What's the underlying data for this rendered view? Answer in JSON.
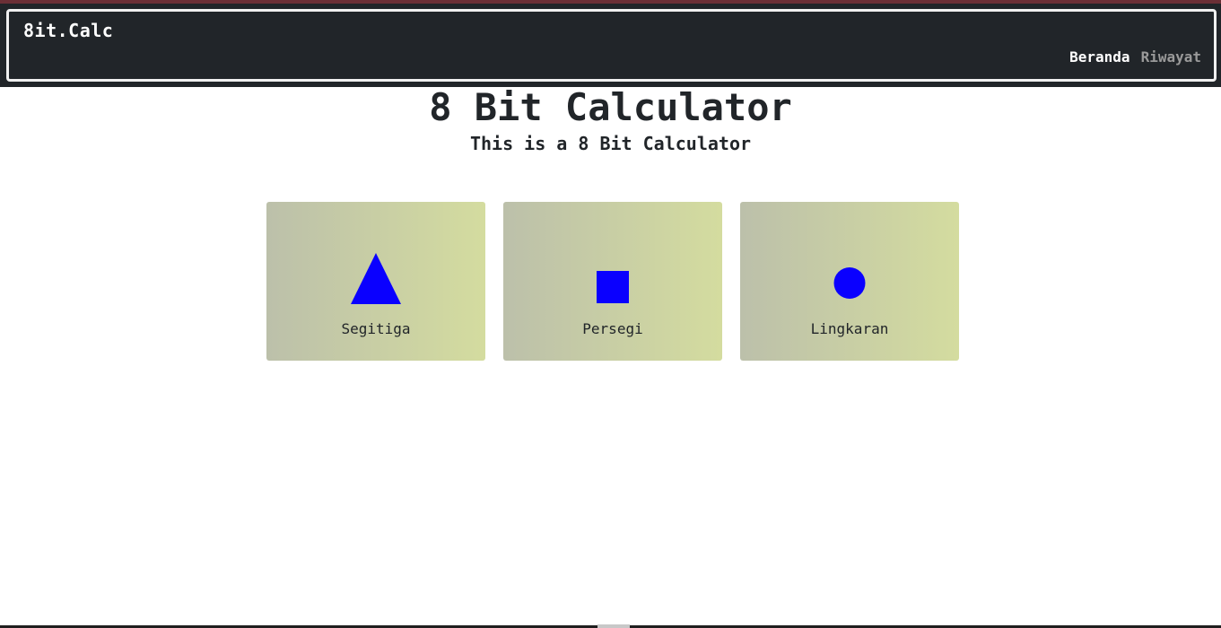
{
  "navbar": {
    "brand": "8it.Calc",
    "links": [
      {
        "label": "Beranda",
        "active": true
      },
      {
        "label": "Riwayat",
        "active": false
      }
    ]
  },
  "hero": {
    "title": "8 Bit Calculator",
    "subtitle": "This is a 8 Bit Calculator"
  },
  "cards": [
    {
      "label": "Segitiga",
      "icon": "triangle-icon"
    },
    {
      "label": "Persegi",
      "icon": "square-icon"
    },
    {
      "label": "Lingkaran",
      "icon": "circle-icon"
    }
  ],
  "colors": {
    "navbar_bg": "#212529",
    "shape_blue": "#0a00ff",
    "card_gradient_start": "#bcc0aa",
    "card_gradient_end": "#d4dc9f",
    "muted_link": "#9a9a9a"
  }
}
